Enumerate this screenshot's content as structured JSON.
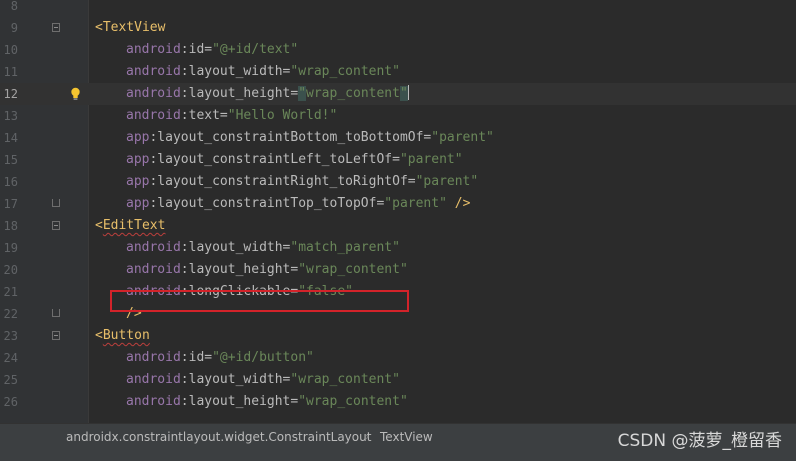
{
  "editor": {
    "lines": [
      {
        "num": "8",
        "tokens": []
      },
      {
        "num": "9",
        "indent": 95,
        "fold": "start",
        "tokens": [
          {
            "t": "<TextView",
            "c": "tag"
          }
        ]
      },
      {
        "num": "10",
        "indent": 126,
        "tokens": [
          {
            "t": "android",
            "c": "ns"
          },
          {
            "t": ":id=",
            "c": "attr"
          },
          {
            "t": "\"@+id/text\"",
            "c": "val"
          }
        ]
      },
      {
        "num": "11",
        "indent": 126,
        "tokens": [
          {
            "t": "android",
            "c": "ns"
          },
          {
            "t": ":layout_width=",
            "c": "attr"
          },
          {
            "t": "\"wrap_content\"",
            "c": "val"
          }
        ]
      },
      {
        "num": "12",
        "indent": 126,
        "current": true,
        "bulb": true,
        "tokens": [
          {
            "t": "android",
            "c": "ns"
          },
          {
            "t": ":layout_height=",
            "c": "attr"
          },
          {
            "t": "\"",
            "c": "val hl-quote"
          },
          {
            "t": "wrap_content",
            "c": "val"
          },
          {
            "t": "\"",
            "c": "val hl-quote"
          }
        ]
      },
      {
        "num": "13",
        "indent": 126,
        "tokens": [
          {
            "t": "android",
            "c": "ns"
          },
          {
            "t": ":text=",
            "c": "attr"
          },
          {
            "t": "\"Hello World!\"",
            "c": "val"
          }
        ]
      },
      {
        "num": "14",
        "indent": 126,
        "tokens": [
          {
            "t": "app",
            "c": "ns"
          },
          {
            "t": ":layout_constraintBottom_toBottomOf=",
            "c": "attr"
          },
          {
            "t": "\"parent\"",
            "c": "val"
          }
        ]
      },
      {
        "num": "15",
        "indent": 126,
        "tokens": [
          {
            "t": "app",
            "c": "ns"
          },
          {
            "t": ":layout_constraintLeft_toLeftOf=",
            "c": "attr"
          },
          {
            "t": "\"parent\"",
            "c": "val"
          }
        ]
      },
      {
        "num": "16",
        "indent": 126,
        "tokens": [
          {
            "t": "app",
            "c": "ns"
          },
          {
            "t": ":layout_constraintRight_toRightOf=",
            "c": "attr"
          },
          {
            "t": "\"parent\"",
            "c": "val"
          }
        ]
      },
      {
        "num": "17",
        "indent": 126,
        "fold": "end",
        "tokens": [
          {
            "t": "app",
            "c": "ns"
          },
          {
            "t": ":layout_constraintTop_toTopOf=",
            "c": "attr"
          },
          {
            "t": "\"parent\"",
            "c": "val"
          },
          {
            "t": " />",
            "c": "tag"
          }
        ]
      },
      {
        "num": "18",
        "indent": 95,
        "fold": "start",
        "tokens": [
          {
            "t": "<",
            "c": "tag"
          },
          {
            "t": "EditText",
            "c": "tag squig"
          }
        ]
      },
      {
        "num": "19",
        "indent": 126,
        "tokens": [
          {
            "t": "android",
            "c": "ns"
          },
          {
            "t": ":layout_width=",
            "c": "attr"
          },
          {
            "t": "\"match_parent\"",
            "c": "val"
          }
        ]
      },
      {
        "num": "20",
        "indent": 126,
        "tokens": [
          {
            "t": "android",
            "c": "ns"
          },
          {
            "t": ":layout_height=",
            "c": "attr"
          },
          {
            "t": "\"wrap_content\"",
            "c": "val"
          }
        ]
      },
      {
        "num": "21",
        "indent": 126,
        "tokens": [
          {
            "t": "android",
            "c": "ns"
          },
          {
            "t": ":longClickable=",
            "c": "attr"
          },
          {
            "t": "\"false\"",
            "c": "val"
          }
        ]
      },
      {
        "num": "22",
        "indent": 126,
        "fold": "end",
        "tokens": [
          {
            "t": "/>",
            "c": "tag"
          }
        ]
      },
      {
        "num": "23",
        "indent": 95,
        "fold": "start",
        "tokens": [
          {
            "t": "<",
            "c": "tag"
          },
          {
            "t": "Button",
            "c": "tag squig"
          }
        ]
      },
      {
        "num": "24",
        "indent": 126,
        "tokens": [
          {
            "t": "android",
            "c": "ns"
          },
          {
            "t": ":id=",
            "c": "attr"
          },
          {
            "t": "\"@+id/button\"",
            "c": "val"
          }
        ]
      },
      {
        "num": "25",
        "indent": 126,
        "tokens": [
          {
            "t": "android",
            "c": "ns"
          },
          {
            "t": ":layout_width=",
            "c": "attr"
          },
          {
            "t": "\"wrap_content\"",
            "c": "val"
          }
        ]
      },
      {
        "num": "26",
        "indent": 126,
        "tokens": [
          {
            "t": "android",
            "c": "ns"
          },
          {
            "t": ":layout_height=",
            "c": "attr"
          },
          {
            "t": "\"wrap_content\"",
            "c": "val"
          }
        ]
      }
    ]
  },
  "statusbar": {
    "breadcrumb_parent": "androidx.constraintlayout.widget.ConstraintLayout",
    "breadcrumb_separator": "›",
    "breadcrumb_child": "TextView"
  },
  "watermark": "CSDN @菠萝_橙留香",
  "colors": {
    "background": "#2b2b2b",
    "tag": "#e8bf6a",
    "namespace": "#9876aa",
    "value": "#6a8759",
    "highlight_box": "#d3232a"
  }
}
